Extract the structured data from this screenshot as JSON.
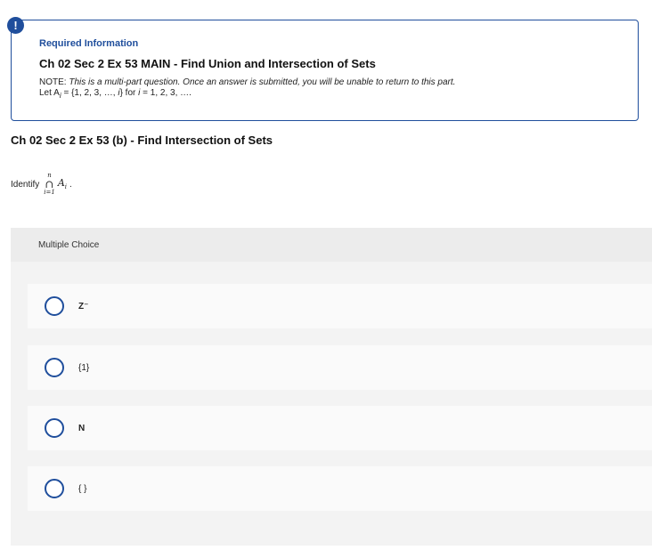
{
  "info": {
    "heading": "Required Information",
    "title": "Ch 02 Sec 2 Ex 53 MAIN - Find Union and Intersection of Sets",
    "note_prefix": "NOTE: ",
    "note_text": "This is a multi-part question. Once an answer is submitted, you will be unable to return to this part.",
    "let_text": "Let A",
    "let_sub": "i",
    "let_rest": " = {1, 2, 3, …, ",
    "let_i": "i",
    "let_end": "} for ",
    "let_i2": "i",
    "let_tail": " = 1, 2, 3, …."
  },
  "question": {
    "part_title": "Ch 02 Sec 2 Ex 53 (b) - Find Intersection of Sets",
    "identify_label": "Identify",
    "op_upper": "n",
    "op_symbol": "∩",
    "op_lower": "i=1",
    "term": "A",
    "term_sub": "i",
    "end_punct": "."
  },
  "multiple_choice": {
    "label": "Multiple Choice",
    "options": [
      "Z⁻",
      "{1}",
      "N",
      "{ }"
    ]
  },
  "colors": {
    "accent": "#1f4e9c",
    "panel_bg": "#f3f3f3",
    "header_bg": "#ececec"
  }
}
